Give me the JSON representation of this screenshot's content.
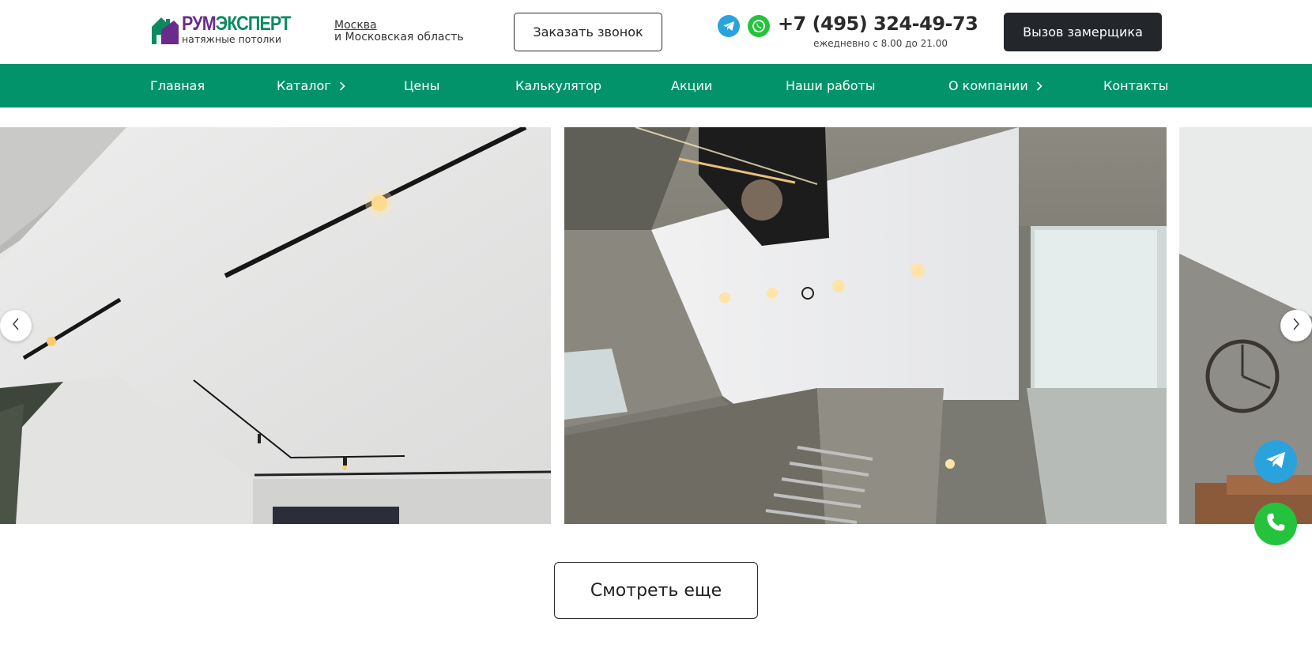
{
  "header": {
    "logo_brand_part1": "РУМ",
    "logo_brand_part2": "ЭКСПЕРТ",
    "logo_subtitle": "натяжные потолки",
    "city_link": "Москва",
    "city_region": "и Московская область",
    "callback_button": "Заказать звонок",
    "phone": "+7 (495) 324-49-73",
    "hours": "ежедневно с 8.00 до 21.00",
    "measure_button": "Вызов замерщика"
  },
  "nav": {
    "items": [
      {
        "label": "Главная",
        "has_submenu": false
      },
      {
        "label": "Каталог",
        "has_submenu": true
      },
      {
        "label": "Цены",
        "has_submenu": false
      },
      {
        "label": "Калькулятор",
        "has_submenu": false
      },
      {
        "label": "Акции",
        "has_submenu": false
      },
      {
        "label": "Наши работы",
        "has_submenu": false
      },
      {
        "label": "О компании",
        "has_submenu": true
      },
      {
        "label": "Контакты",
        "has_submenu": false
      }
    ]
  },
  "gallery": {
    "more_button": "Смотреть еще"
  },
  "icons": {
    "telegram": "telegram-icon",
    "whatsapp": "whatsapp-icon",
    "prev": "chevron-left-icon",
    "next": "chevron-right-icon"
  },
  "colors": {
    "brand_green": "#03936a",
    "brand_purple": "#6a2c8c",
    "dark_button": "#23262b",
    "telegram": "#2aa3dd",
    "whatsapp": "#25c23d"
  }
}
